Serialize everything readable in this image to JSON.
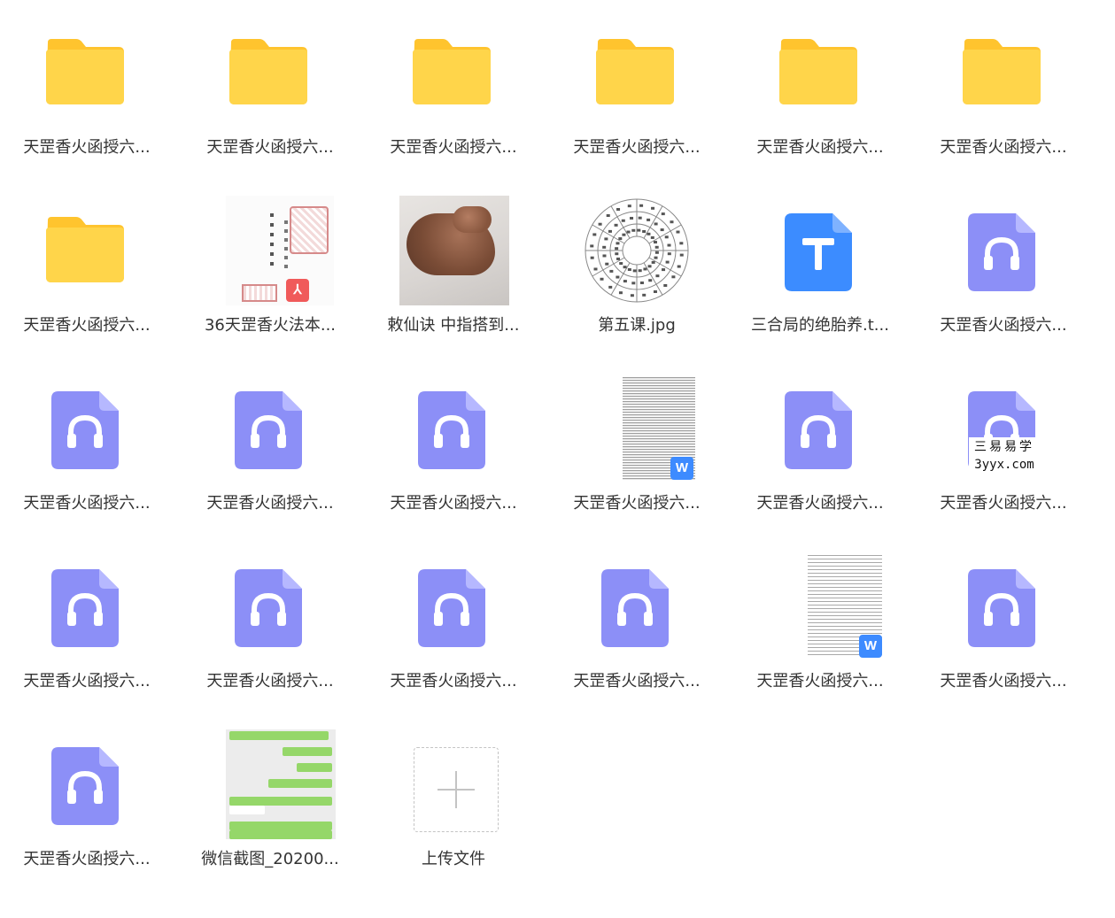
{
  "items": [
    {
      "type": "folder",
      "label": "天罡香火函授六..."
    },
    {
      "type": "folder",
      "label": "天罡香火函授六..."
    },
    {
      "type": "folder",
      "label": "天罡香火函授六..."
    },
    {
      "type": "folder",
      "label": "天罡香火函授六..."
    },
    {
      "type": "folder",
      "label": "天罡香火函授六..."
    },
    {
      "type": "folder",
      "label": "天罡香火函授六..."
    },
    {
      "type": "folder",
      "label": "天罡香火函授六..."
    },
    {
      "type": "pdf",
      "label": "36天罡香火法本..."
    },
    {
      "type": "photo",
      "label": "敕仙诀 中指搭到..."
    },
    {
      "type": "image",
      "label": "第五课.jpg"
    },
    {
      "type": "txt",
      "label": "三合局的绝胎养.t..."
    },
    {
      "type": "audio",
      "label": "天罡香火函授六..."
    },
    {
      "type": "audio",
      "label": "天罡香火函授六..."
    },
    {
      "type": "audio",
      "label": "天罡香火函授六..."
    },
    {
      "type": "audio",
      "label": "天罡香火函授六..."
    },
    {
      "type": "word",
      "label": "天罡香火函授六..."
    },
    {
      "type": "audio",
      "label": "天罡香火函授六..."
    },
    {
      "type": "audio",
      "label": "天罡香火函授六..."
    },
    {
      "type": "audio",
      "label": "天罡香火函授六..."
    },
    {
      "type": "audio",
      "label": "天罡香火函授六..."
    },
    {
      "type": "audio",
      "label": "天罡香火函授六..."
    },
    {
      "type": "audio",
      "label": "天罡香火函授六..."
    },
    {
      "type": "word",
      "label": "天罡香火函授六..."
    },
    {
      "type": "audio",
      "label": "天罡香火函授六..."
    },
    {
      "type": "audio",
      "label": "天罡香火函授六..."
    },
    {
      "type": "chat-screenshot",
      "label": "微信截图_20200..."
    }
  ],
  "upload": {
    "label": "上传文件",
    "icon": "plus-icon"
  },
  "badges": {
    "pdf": "pdf-icon",
    "word": "W",
    "txt": "T"
  },
  "watermark": {
    "line1": "三易易学",
    "line2": "3yyx.com"
  },
  "colors": {
    "folder": "#ffd54a",
    "folder_tab": "#ffc42e",
    "audio": "#8c8ff7",
    "audio_fold": "#b6b8ff",
    "txt": "#3c8cff",
    "word_badge": "#3d8bff",
    "pdf_badge": "#f05a5a",
    "label_text": "#333333"
  }
}
